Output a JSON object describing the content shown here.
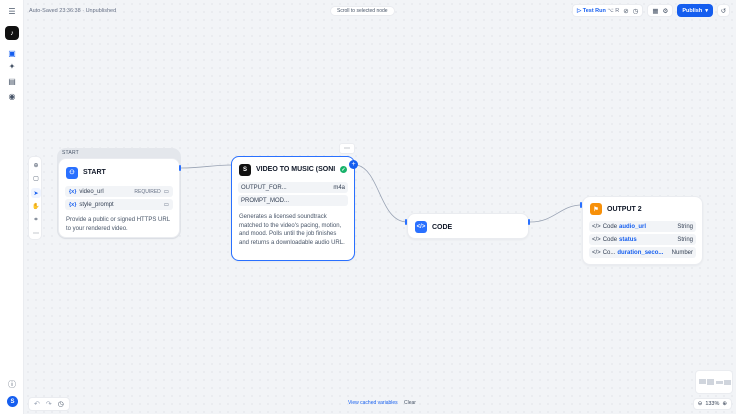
{
  "topbar": {
    "autosave_status": "Auto-Saved 23:36:38 · Unpublished",
    "scroll_to_selected": "Scroll to selected node",
    "test_run_label": "Test Run",
    "test_run_shortcut": "⌥ R",
    "publish_label": "Publish"
  },
  "sidebar": {
    "avatar_initial": "S"
  },
  "nodes": {
    "start": {
      "group_label": "START",
      "title": "START",
      "variables": [
        {
          "name": "video_url",
          "tag": "REQUIRED"
        },
        {
          "name": "style_prompt",
          "tag": ""
        }
      ],
      "description": "Provide a public or signed HTTPS URL to your rendered video."
    },
    "video_to_music": {
      "title": "VIDEO TO MUSIC (SONI...",
      "params": [
        {
          "key": "OUTPUT_FOR...",
          "value": "m4a"
        },
        {
          "key": "PROMPT_MOD...",
          "value": ""
        }
      ],
      "description": "Generates a licensed soundtrack matched to the video's pacing, motion, and mood. Polls until the job finishes and returns a downloadable audio URL."
    },
    "code": {
      "title": "CODE"
    },
    "output": {
      "title": "OUTPUT 2",
      "rows": [
        {
          "source": "Code",
          "variable": "audio_url",
          "type": "String"
        },
        {
          "source": "Code",
          "variable": "status",
          "type": "String"
        },
        {
          "source": "Co...",
          "variable": "duration_seco...",
          "type": "Number"
        }
      ]
    }
  },
  "bottom": {
    "view_cached": "View cached variables",
    "clear": "Clear",
    "zoom": "133%"
  },
  "colors": {
    "accent": "#155eef",
    "success": "#17b26a",
    "output_icon": "#f79009",
    "start_icon": "#2970ff"
  }
}
